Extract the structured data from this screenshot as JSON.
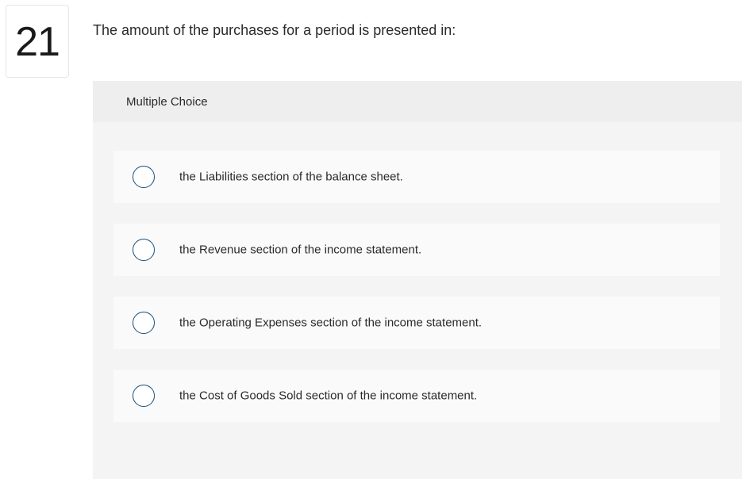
{
  "question": {
    "number": "21",
    "text": "The amount of the purchases for a period is presented in:"
  },
  "choices": {
    "header": "Multiple Choice",
    "options": [
      {
        "label": "the Liabilities section of the balance sheet."
      },
      {
        "label": "the Revenue section of the income statement."
      },
      {
        "label": "the Operating Expenses section of the income statement."
      },
      {
        "label": "the Cost of Goods Sold section of the income statement."
      }
    ]
  },
  "colors": {
    "radio_border": "#1a4f7a",
    "panel_bg": "#f4f4f4",
    "header_bg": "#eeeeee",
    "option_bg": "#fafafa"
  }
}
